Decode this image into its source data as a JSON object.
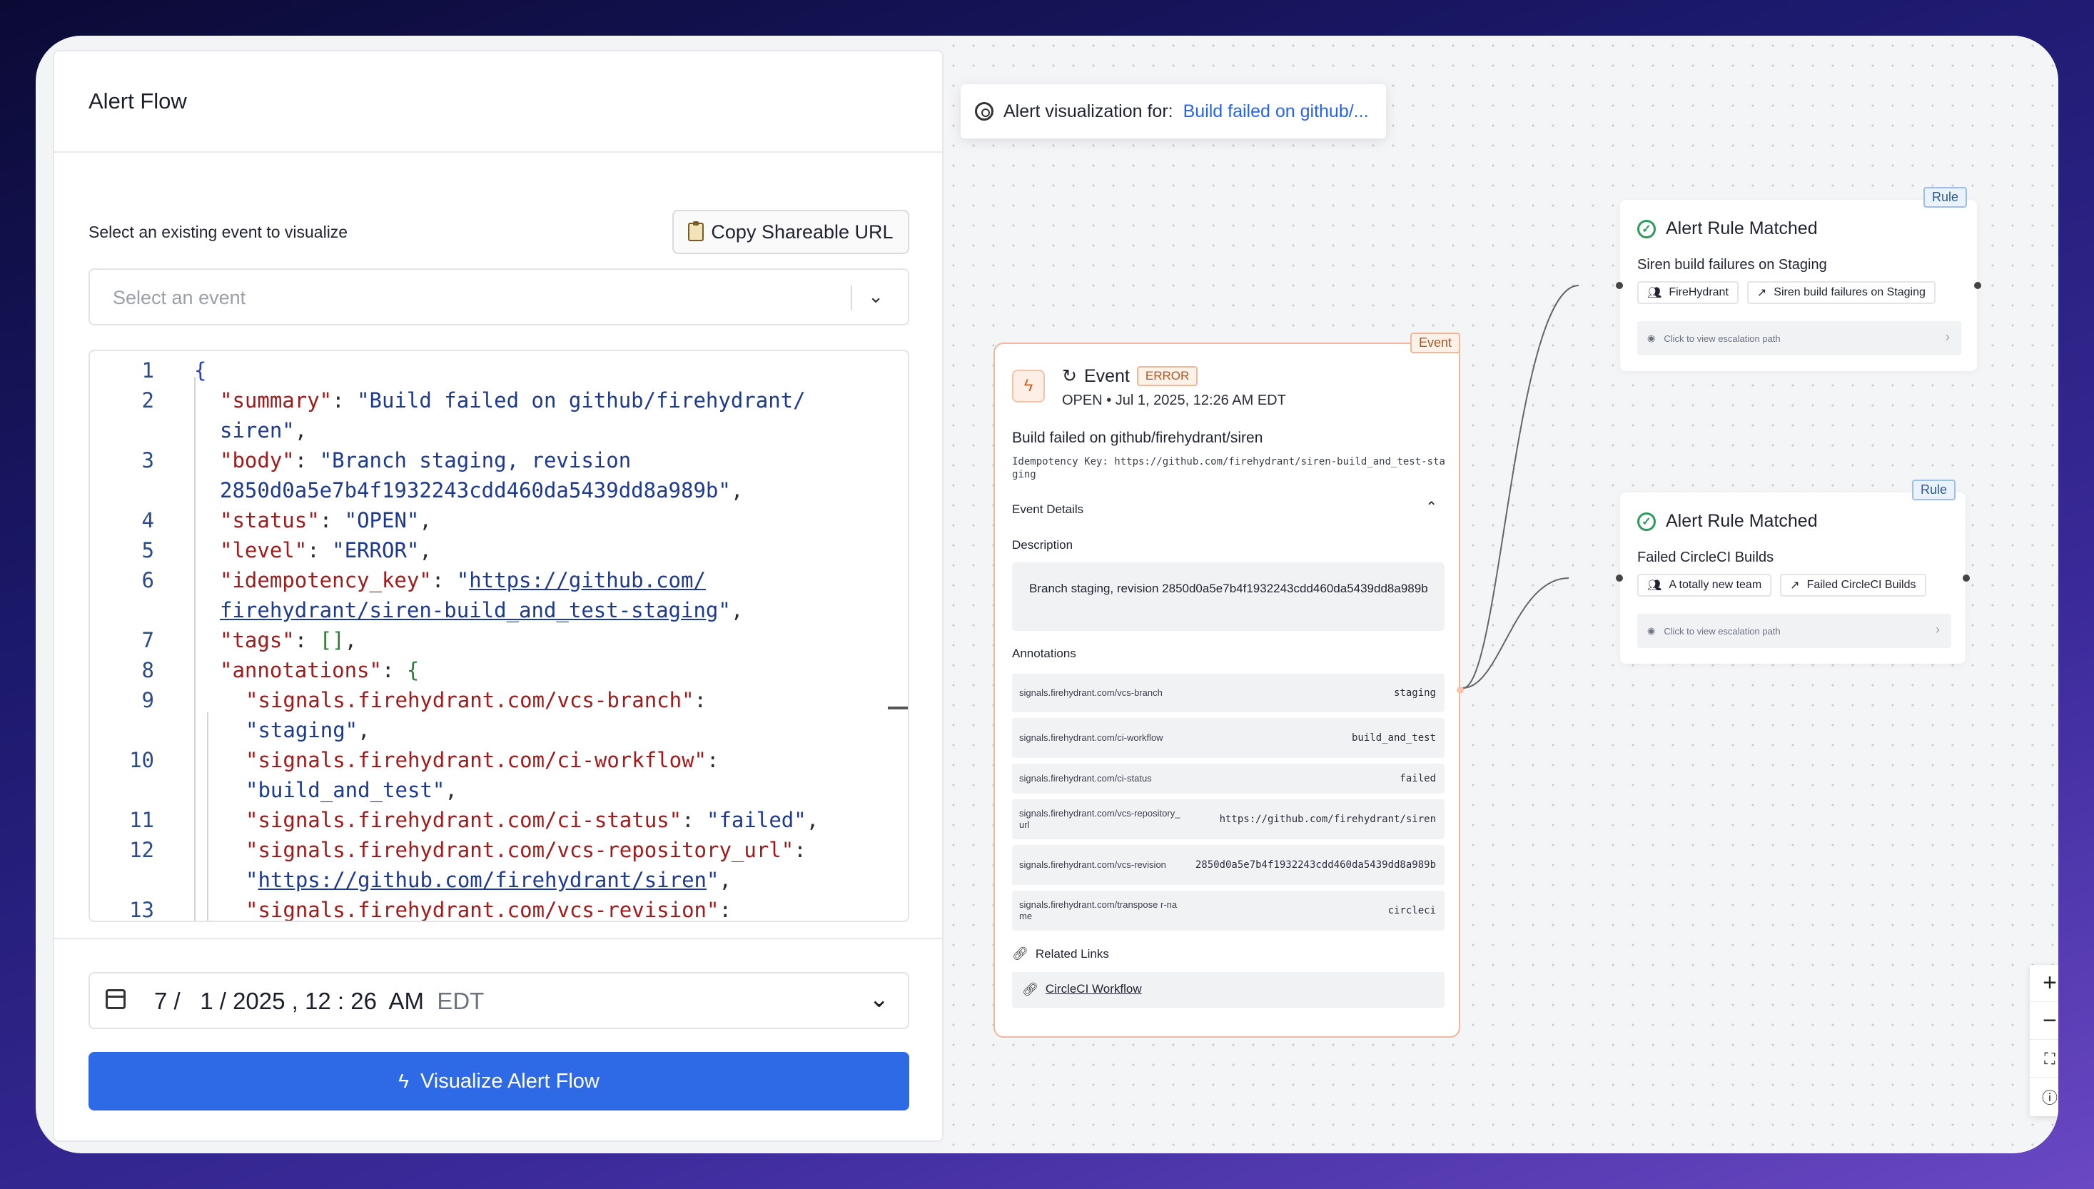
{
  "left_panel": {
    "title": "Alert Flow",
    "select_label": "Select an existing event to visualize",
    "copy_button_label": "Copy Shareable URL",
    "select_placeholder": "Select an event",
    "date": {
      "month": "7",
      "day": "1",
      "year": "2025",
      "hour": "12",
      "minute": "26",
      "ampm": "AM",
      "tz": "EDT"
    },
    "visualize_button_label": "Visualize Alert Flow"
  },
  "code_lines": [
    {
      "n": "1",
      "show_n": true
    },
    {
      "n": "2",
      "show_n": true
    },
    {
      "n": "",
      "show_n": false
    },
    {
      "n": "3",
      "show_n": true
    },
    {
      "n": "",
      "show_n": false
    },
    {
      "n": "4",
      "show_n": true
    },
    {
      "n": "5",
      "show_n": true
    },
    {
      "n": "6",
      "show_n": true
    },
    {
      "n": "",
      "show_n": false
    },
    {
      "n": "7",
      "show_n": true
    },
    {
      "n": "8",
      "show_n": true
    },
    {
      "n": "9",
      "show_n": true
    },
    {
      "n": "",
      "show_n": false
    },
    {
      "n": "10",
      "show_n": true
    },
    {
      "n": "",
      "show_n": false
    },
    {
      "n": "11",
      "show_n": true
    },
    {
      "n": "12",
      "show_n": true
    },
    {
      "n": "",
      "show_n": false
    },
    {
      "n": "13",
      "show_n": true
    }
  ],
  "code": {
    "brace_open": "{",
    "summary_key": "\"summary\"",
    "summary_val_1": "\"Build failed on github/firehydrant/",
    "summary_val_2": "siren\"",
    "body_key": "\"body\"",
    "body_val_1": "\"Branch staging, revision",
    "body_val_2": "2850d0a5e7b4f1932243cdd460da5439dd8a989b\"",
    "status_key": "\"status\"",
    "status_val": "\"OPEN\"",
    "level_key": "\"level\"",
    "level_val": "\"ERROR\"",
    "idem_key": "\"idempotency_key\"",
    "idem_val_1": "https://github.com/",
    "idem_val_2": "firehydrant/siren-build_and_test-staging",
    "tags_key": "\"tags\"",
    "tags_val": "[]",
    "ann_key": "\"annotations\"",
    "ann_open": "{",
    "a1_key": "\"signals.firehydrant.com/vcs-branch\"",
    "a1_val": "\"staging\"",
    "a2_key": "\"signals.firehydrant.com/ci-workflow\"",
    "a2_val": "\"build_and_test\"",
    "a3_key": "\"signals.firehydrant.com/ci-status\"",
    "a3_val": "\"failed\"",
    "a4_key": "\"signals.firehydrant.com/vcs-repository_url\"",
    "a4_val": "https://github.com/firehydrant/siren",
    "a5_key": "\"signals.firehydrant.com/vcs-revision\""
  },
  "canvas": {
    "viz_label": "Alert visualization for:",
    "viz_link": "Build failed on github/...",
    "event": {
      "tag": "Event",
      "title": "Event",
      "level_badge": "ERROR",
      "subtitle": "OPEN • Jul 1, 2025, 12:26 AM EDT",
      "summary": "Build failed on github/firehydrant/siren",
      "idempotency": "Idempotency Key: https://github.com/firehydrant/siren-build_and_test-staging",
      "details_label": "Event Details",
      "description_label": "Description",
      "description": "Branch staging, revision 2850d0a5e7b4f1932243cdd460da5439dd8a989b",
      "annotations_label": "Annotations",
      "annotations": [
        {
          "key": "signals.firehydrant.com/vcs-branch",
          "value": "staging"
        },
        {
          "key": "signals.firehydrant.com/ci-workflow",
          "value": "build_and_test"
        },
        {
          "key": "signals.firehydrant.com/ci-status",
          "value": "failed"
        },
        {
          "key": "signals.firehydrant.com/vcs-repository_url",
          "value": "https://github.com/firehydrant/siren"
        },
        {
          "key": "signals.firehydrant.com/vcs-revision",
          "value": "2850d0a5e7b4f1932243cdd460da5439dd8a989b"
        },
        {
          "key": "signals.firehydrant.com/transpose r-name",
          "value": "circleci"
        }
      ],
      "related_label": "Related Links",
      "related_link": "CircleCI Workflow"
    },
    "rules": [
      {
        "tag": "Rule",
        "title": "Alert Rule Matched",
        "name": "Siren build failures on Staging",
        "team": "FireHydrant",
        "rule_chip": "Siren build failures on Staging",
        "escalation": "Click to view escalation path"
      },
      {
        "tag": "Rule",
        "title": "Alert Rule Matched",
        "name": "Failed CircleCI Builds",
        "team": "A totally new team",
        "rule_chip": "Failed CircleCI Builds",
        "escalation": "Click to view escalation path"
      }
    ],
    "zoom_controls": [
      "zoom-in",
      "zoom-out",
      "fit-view",
      "help"
    ],
    "colors": {
      "primary": "#2e6ae6",
      "event_border": "#f1b79a",
      "rule_tag": "#9ec0e8",
      "check": "#2e9b5e"
    }
  }
}
